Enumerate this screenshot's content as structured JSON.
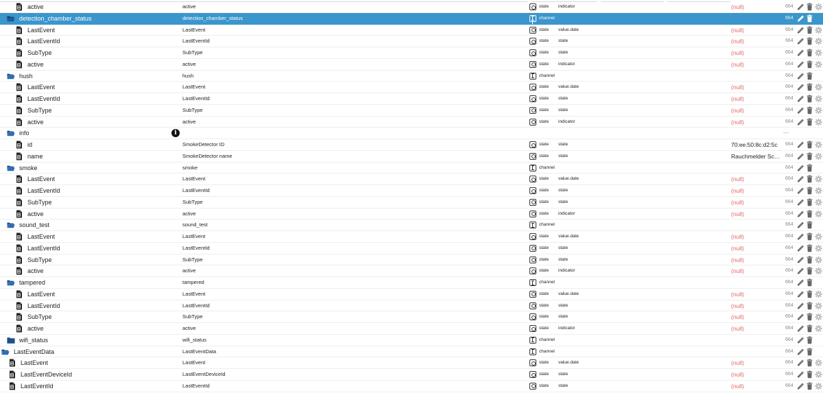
{
  "rows": [
    {
      "name": "active",
      "indent": 22,
      "kind": "file",
      "title": "active",
      "type": "state",
      "role": "indicator",
      "value": "(null)",
      "acl": "664",
      "actions": "full"
    },
    {
      "name": "detection_chamber_status",
      "indent": 10,
      "kind": "folder-open",
      "title": "detection_chamber_status",
      "type": "channel",
      "role": "",
      "value": "",
      "acl": "664",
      "actions": "edit-delete",
      "selected": true
    },
    {
      "name": "LastEvent",
      "indent": 22,
      "kind": "file",
      "title": "LastEvent",
      "type": "state",
      "role": "value.date",
      "value": "(null)",
      "acl": "664",
      "actions": "full"
    },
    {
      "name": "LastEventId",
      "indent": 22,
      "kind": "file",
      "title": "LastEventId",
      "type": "state",
      "role": "state",
      "value": "(null)",
      "acl": "664",
      "actions": "full"
    },
    {
      "name": "SubType",
      "indent": 22,
      "kind": "file",
      "title": "SubType",
      "type": "state",
      "role": "state",
      "value": "(null)",
      "acl": "664",
      "actions": "full"
    },
    {
      "name": "active",
      "indent": 22,
      "kind": "file",
      "title": "active",
      "type": "state",
      "role": "indicator",
      "value": "(null)",
      "acl": "664",
      "actions": "full"
    },
    {
      "name": "hush",
      "indent": 10,
      "kind": "folder-open",
      "title": "hush",
      "type": "channel",
      "role": "",
      "value": "",
      "acl": "664",
      "actions": "edit-delete"
    },
    {
      "name": "LastEvent",
      "indent": 22,
      "kind": "file",
      "title": "LastEvent",
      "type": "state",
      "role": "value.date",
      "value": "(null)",
      "acl": "664",
      "actions": "full"
    },
    {
      "name": "LastEventId",
      "indent": 22,
      "kind": "file",
      "title": "LastEventId",
      "type": "state",
      "role": "state",
      "value": "(null)",
      "acl": "664",
      "actions": "full"
    },
    {
      "name": "SubType",
      "indent": 22,
      "kind": "file",
      "title": "SubType",
      "type": "state",
      "role": "state",
      "value": "(null)",
      "acl": "664",
      "actions": "full"
    },
    {
      "name": "active",
      "indent": 22,
      "kind": "file",
      "title": "active",
      "type": "state",
      "role": "indicator",
      "value": "(null)",
      "acl": "664",
      "actions": "full"
    },
    {
      "name": "info",
      "indent": 10,
      "kind": "folder-open",
      "title": "",
      "type": "",
      "role": "",
      "value": "",
      "acl": "",
      "actions": "dash",
      "info": true
    },
    {
      "name": "id",
      "indent": 22,
      "kind": "file",
      "title": "SmokeDetector ID",
      "type": "state",
      "role": "state",
      "value": "70:ee:50:8c:d2:5c",
      "acl": "664",
      "actions": "full"
    },
    {
      "name": "name",
      "indent": 22,
      "kind": "file",
      "title": "SmokeDetector name",
      "type": "state",
      "role": "state",
      "value": "Rauchmelder Schl...",
      "acl": "664",
      "actions": "full"
    },
    {
      "name": "smoke",
      "indent": 10,
      "kind": "folder-open",
      "title": "smoke",
      "type": "channel",
      "role": "",
      "value": "",
      "acl": "664",
      "actions": "edit-delete"
    },
    {
      "name": "LastEvent",
      "indent": 22,
      "kind": "file",
      "title": "LastEvent",
      "type": "state",
      "role": "value.date",
      "value": "(null)",
      "acl": "664",
      "actions": "full"
    },
    {
      "name": "LastEventId",
      "indent": 22,
      "kind": "file",
      "title": "LastEventId",
      "type": "state",
      "role": "state",
      "value": "(null)",
      "acl": "664",
      "actions": "full"
    },
    {
      "name": "SubType",
      "indent": 22,
      "kind": "file",
      "title": "SubType",
      "type": "state",
      "role": "state",
      "value": "(null)",
      "acl": "664",
      "actions": "full"
    },
    {
      "name": "active",
      "indent": 22,
      "kind": "file",
      "title": "active",
      "type": "state",
      "role": "indicator",
      "value": "(null)",
      "acl": "664",
      "actions": "full"
    },
    {
      "name": "sound_test",
      "indent": 10,
      "kind": "folder-open",
      "title": "sound_test",
      "type": "channel",
      "role": "",
      "value": "",
      "acl": "664",
      "actions": "edit-delete"
    },
    {
      "name": "LastEvent",
      "indent": 22,
      "kind": "file",
      "title": "LastEvent",
      "type": "state",
      "role": "value.date",
      "value": "(null)",
      "acl": "664",
      "actions": "full"
    },
    {
      "name": "LastEventId",
      "indent": 22,
      "kind": "file",
      "title": "LastEventId",
      "type": "state",
      "role": "state",
      "value": "(null)",
      "acl": "664",
      "actions": "full"
    },
    {
      "name": "SubType",
      "indent": 22,
      "kind": "file",
      "title": "SubType",
      "type": "state",
      "role": "state",
      "value": "(null)",
      "acl": "664",
      "actions": "full"
    },
    {
      "name": "active",
      "indent": 22,
      "kind": "file",
      "title": "active",
      "type": "state",
      "role": "indicator",
      "value": "(null)",
      "acl": "664",
      "actions": "full"
    },
    {
      "name": "tampered",
      "indent": 10,
      "kind": "folder-open",
      "title": "tampered",
      "type": "channel",
      "role": "",
      "value": "",
      "acl": "664",
      "actions": "edit-delete"
    },
    {
      "name": "LastEvent",
      "indent": 22,
      "kind": "file",
      "title": "LastEvent",
      "type": "state",
      "role": "value.date",
      "value": "(null)",
      "acl": "664",
      "actions": "full"
    },
    {
      "name": "LastEventId",
      "indent": 22,
      "kind": "file",
      "title": "LastEventId",
      "type": "state",
      "role": "state",
      "value": "(null)",
      "acl": "664",
      "actions": "full"
    },
    {
      "name": "SubType",
      "indent": 22,
      "kind": "file",
      "title": "SubType",
      "type": "state",
      "role": "state",
      "value": "(null)",
      "acl": "664",
      "actions": "full"
    },
    {
      "name": "active",
      "indent": 22,
      "kind": "file",
      "title": "active",
      "type": "state",
      "role": "indicator",
      "value": "(null)",
      "acl": "664",
      "actions": "full"
    },
    {
      "name": "wifi_status",
      "indent": 10,
      "kind": "folder-closed",
      "title": "wifi_status",
      "type": "channel",
      "role": "",
      "value": "",
      "acl": "664",
      "actions": "edit-delete"
    },
    {
      "name": "LastEventData",
      "indent": 2,
      "kind": "folder-open",
      "title": "LastEventData",
      "type": "channel",
      "role": "",
      "value": "",
      "acl": "664",
      "actions": "edit-delete"
    },
    {
      "name": "LastEvent",
      "indent": 12,
      "kind": "file",
      "title": "LastEvent",
      "type": "state",
      "role": "value.date",
      "value": "(null)",
      "acl": "664",
      "actions": "full"
    },
    {
      "name": "LastEventDeviceId",
      "indent": 12,
      "kind": "file",
      "title": "LastEventDeviceId",
      "type": "state",
      "role": "state",
      "value": "(null)",
      "acl": "664",
      "actions": "full"
    },
    {
      "name": "LastEventId",
      "indent": 12,
      "kind": "file",
      "title": "LastEventId",
      "type": "state",
      "role": "state",
      "value": "(null)",
      "acl": "664",
      "actions": "full"
    }
  ],
  "info_symbol": "i",
  "dash_symbol": "—",
  "colors": {
    "selected": "#3a96cc",
    "null": "#e06666",
    "folder": "#1c4f8a"
  }
}
